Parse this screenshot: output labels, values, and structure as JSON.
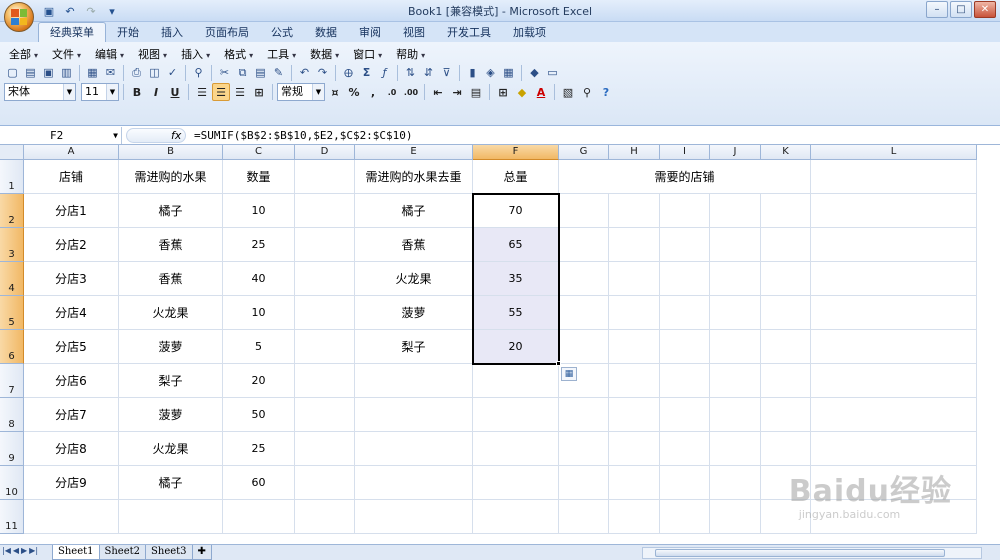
{
  "window": {
    "title": "Book1  [兼容模式] - Microsoft Excel"
  },
  "ribbon_tabs": [
    "经典菜单",
    "开始",
    "插入",
    "页面布局",
    "公式",
    "数据",
    "审阅",
    "视图",
    "开发工具",
    "加载项"
  ],
  "menus": [
    "全部",
    "编辑",
    "视图",
    "插入",
    "格式",
    "工具",
    "数据",
    "窗口",
    "帮助"
  ],
  "menu_first": "文件",
  "font": {
    "name": "宋体",
    "size": "11"
  },
  "number_format": "常规",
  "formula_bar": {
    "name_box": "F2",
    "fx_label": "fx",
    "formula": "=SUMIF($B$2:$B$10,$E2,$C$2:$C$10)"
  },
  "columns": [
    "A",
    "B",
    "C",
    "D",
    "E",
    "F",
    "G",
    "H",
    "I",
    "J",
    "K",
    "L"
  ],
  "rows": [
    "1",
    "2",
    "3",
    "4",
    "5",
    "6",
    "7",
    "8",
    "9",
    "10",
    "11"
  ],
  "headers": {
    "a": "店铺",
    "b": "需进购的水果",
    "c": "数量",
    "e": "需进购的水果去重",
    "f": "总量",
    "gk": "需要的店铺"
  },
  "data_rows": [
    {
      "store": "分店1",
      "fruit": "橘子",
      "qty": "10"
    },
    {
      "store": "分店2",
      "fruit": "香蕉",
      "qty": "25"
    },
    {
      "store": "分店3",
      "fruit": "香蕉",
      "qty": "40"
    },
    {
      "store": "分店4",
      "fruit": "火龙果",
      "qty": "10"
    },
    {
      "store": "分店5",
      "fruit": "菠萝",
      "qty": "5"
    },
    {
      "store": "分店6",
      "fruit": "梨子",
      "qty": "20"
    },
    {
      "store": "分店7",
      "fruit": "菠萝",
      "qty": "50"
    },
    {
      "store": "分店8",
      "fruit": "火龙果",
      "qty": "25"
    },
    {
      "store": "分店9",
      "fruit": "橘子",
      "qty": "60"
    }
  ],
  "dedup_rows": [
    {
      "fruit": "橘子",
      "total": "70"
    },
    {
      "fruit": "香蕉",
      "total": "65"
    },
    {
      "fruit": "火龙果",
      "total": "35"
    },
    {
      "fruit": "菠萝",
      "total": "55"
    },
    {
      "fruit": "梨子",
      "total": "20"
    }
  ],
  "sheets": [
    "Sheet1",
    "Sheet2",
    "Sheet3"
  ],
  "active_sheet": "Sheet1",
  "watermark": {
    "brand": "Baidu经验",
    "url": "jingyan.baidu.com"
  },
  "colors": {
    "selection_header": "#f1b865",
    "highlight": "#e8e8f6"
  }
}
